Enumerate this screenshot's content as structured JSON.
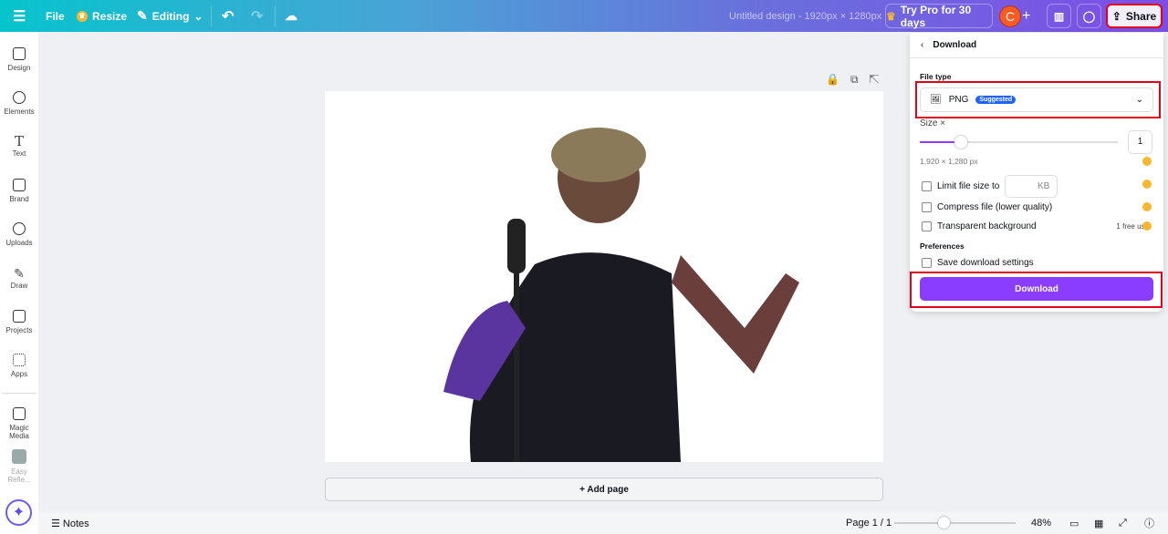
{
  "topbar": {
    "file": "File",
    "resize": "Resize",
    "editing": "Editing",
    "design_title": "Untitled design - 1920px × 1280px",
    "try_pro": "Try Pro for 30 days",
    "avatar_initial": "C",
    "share": "Share"
  },
  "sidebar": {
    "items": [
      {
        "label": "Design"
      },
      {
        "label": "Elements"
      },
      {
        "label": "Text"
      },
      {
        "label": "Brand"
      },
      {
        "label": "Uploads"
      },
      {
        "label": "Draw"
      },
      {
        "label": "Projects"
      },
      {
        "label": "Apps"
      },
      {
        "label": "Magic Media"
      },
      {
        "label": "Easy Refle..."
      }
    ]
  },
  "canvas": {
    "add_page": "+ Add page"
  },
  "bottombar": {
    "notes": "Notes",
    "page": "Page 1 / 1",
    "zoom": "48%",
    "zoom_fraction": 0.48
  },
  "download_panel": {
    "title": "Download",
    "file_type_label": "File type",
    "file_type": "PNG",
    "badge": "Suggested",
    "size_label": "Size ×",
    "size_value": "1",
    "size_slider_fraction": 0.2,
    "dimensions": "1,920 × 1,280 px",
    "limit_label": "Limit file size to",
    "kb_unit": "KB",
    "compress_label": "Compress file (lower quality)",
    "transparent_label": "Transparent background",
    "free_use": "1 free use",
    "preferences_label": "Preferences",
    "save_settings_label": "Save download settings",
    "download_button": "Download"
  },
  "colors": {
    "accent": "#8b3dff",
    "badge": "#1f62ff",
    "crown": "#f7b731",
    "avatar": "#ff5a1f"
  }
}
